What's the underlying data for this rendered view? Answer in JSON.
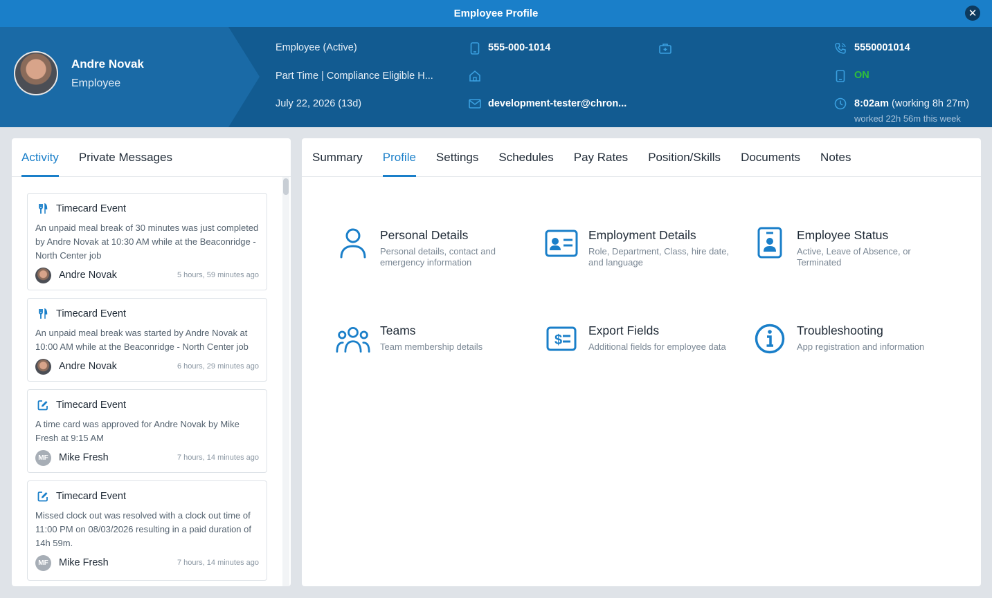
{
  "window": {
    "title": "Employee Profile",
    "close_glyph": "✕"
  },
  "employee": {
    "name": "Andre Novak",
    "role": "Employee",
    "status": "Employee (Active)",
    "employment": "Part Time | Compliance Eligible H...",
    "date": "July 22, 2026 (13d)",
    "mobile": "555-000-1014",
    "email": "development-tester@chron...",
    "phone_alt": "5550001014",
    "app_status": "ON",
    "clock_time": "8:02am",
    "clock_working": " (working 8h 27m)",
    "worked_week": "worked 22h 56m this week"
  },
  "colors": {
    "accent": "#1a7fc9",
    "header": "#125b91",
    "on": "#2fbf3a"
  },
  "left_tabs": [
    {
      "label": "Activity",
      "active": true
    },
    {
      "label": "Private Messages",
      "active": false
    }
  ],
  "activity": [
    {
      "icon": "utensils-icon",
      "title": "Timecard Event",
      "body": "An unpaid meal break of 30 minutes was just completed by Andre Novak at 10:30 AM while at the Beaconridge - North Center job",
      "user": "Andre Novak",
      "avatar": "photo",
      "initials": "",
      "time": "5 hours, 59 minutes ago"
    },
    {
      "icon": "utensils-icon",
      "title": "Timecard Event",
      "body": "An unpaid meal break was started by Andre Novak at 10:00 AM while at the Beaconridge - North Center job",
      "user": "Andre Novak",
      "avatar": "photo",
      "initials": "",
      "time": "6 hours, 29 minutes ago"
    },
    {
      "icon": "edit-icon",
      "title": "Timecard Event",
      "body": "A time card was approved for Andre Novak by Mike Fresh at 9:15 AM",
      "user": "Mike Fresh",
      "avatar": "initials",
      "initials": "MF",
      "time": "7 hours, 14 minutes ago"
    },
    {
      "icon": "edit-icon",
      "title": "Timecard Event",
      "body": "Missed clock out was resolved with a clock out time of 11:00 PM on 08/03/2026 resulting in a paid duration of 14h 59m.",
      "user": "Mike Fresh",
      "avatar": "initials",
      "initials": "MF",
      "time": "7 hours, 14 minutes ago"
    }
  ],
  "right_tabs": [
    {
      "label": "Summary",
      "active": false
    },
    {
      "label": "Profile",
      "active": true
    },
    {
      "label": "Settings",
      "active": false
    },
    {
      "label": "Schedules",
      "active": false
    },
    {
      "label": "Pay Rates",
      "active": false
    },
    {
      "label": "Position/Skills",
      "active": false
    },
    {
      "label": "Documents",
      "active": false
    },
    {
      "label": "Notes",
      "active": false
    }
  ],
  "tiles": [
    {
      "icon": "person-icon",
      "title": "Personal Details",
      "desc": "Personal details, contact and emergency information"
    },
    {
      "icon": "id-card-icon",
      "title": "Employment Details",
      "desc": "Role, Department, Class, hire date, and language"
    },
    {
      "icon": "badge-icon",
      "title": "Employee Status",
      "desc": "Active, Leave of Absence, or Terminated"
    },
    {
      "icon": "team-icon",
      "title": "Teams",
      "desc": "Team membership details"
    },
    {
      "icon": "dollar-card-icon",
      "title": "Export Fields",
      "desc": "Additional fields for employee data"
    },
    {
      "icon": "info-icon",
      "title": "Troubleshooting",
      "desc": "App registration and information"
    }
  ]
}
